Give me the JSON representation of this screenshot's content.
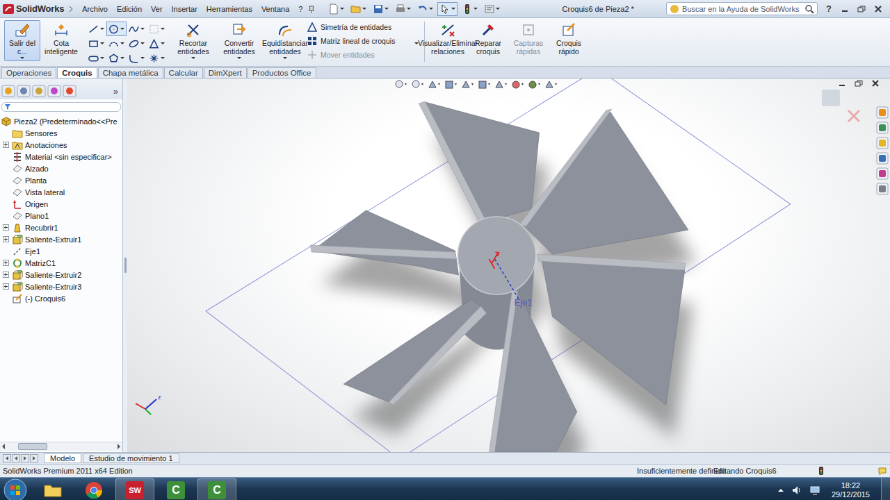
{
  "titlebar": {
    "logo": "SolidWorks",
    "menu": [
      "Archivo",
      "Edición",
      "Ver",
      "Insertar",
      "Herramientas",
      "Ventana",
      "?"
    ],
    "document": "Croquis6 de Pieza2 *",
    "search": {
      "placeholder": "Buscar en la Ayuda de SolidWorks"
    },
    "help": "?"
  },
  "ribbon": {
    "exit": {
      "label": "Salir del c...",
      "selected": true
    },
    "dimension": {
      "label": "Cota inteligente"
    },
    "sketch_tools": [
      {
        "kind": "line",
        "selected": false
      },
      {
        "kind": "circle",
        "selected": true
      },
      {
        "kind": "spline",
        "selected": false
      },
      {
        "kind": "grid",
        "selected": false
      },
      {
        "kind": "rectangle",
        "selected": false
      },
      {
        "kind": "arc",
        "selected": false
      },
      {
        "kind": "ellipse",
        "selected": false
      },
      {
        "kind": "text",
        "selected": false
      },
      {
        "kind": "slot",
        "selected": false
      },
      {
        "kind": "polygon",
        "selected": false
      },
      {
        "kind": "fillet",
        "selected": false
      },
      {
        "kind": "point",
        "selected": false
      }
    ],
    "entity_tools": [
      {
        "label": "Recortar entidades",
        "kind": "trim"
      },
      {
        "label": "Convertir entidades",
        "kind": "convert"
      },
      {
        "label": "Equidistanciar entidades",
        "kind": "offset"
      }
    ],
    "small_tools": [
      {
        "label": "Simetría de entidades",
        "kind": "mirror",
        "disabled": false
      },
      {
        "label": "Matriz lineal de croquis",
        "kind": "pattern",
        "disabled": false
      },
      {
        "label": "Mover entidades",
        "kind": "move",
        "disabled": true
      }
    ],
    "relation_tools": [
      {
        "label": "Visualizar/Eliminar relaciones",
        "kind": "relations",
        "disabled": false
      },
      {
        "label": "Reparar croquis",
        "kind": "repair",
        "disabled": false
      },
      {
        "label": "Capturas rápidas",
        "kind": "snaps",
        "disabled": true
      },
      {
        "label": "Croquis rápido",
        "kind": "rapid",
        "disabled": false
      }
    ]
  },
  "tabs": [
    {
      "label": "Operaciones",
      "selected": false
    },
    {
      "label": "Croquis",
      "selected": true
    },
    {
      "label": "Chapa metálica",
      "selected": false
    },
    {
      "label": "Calcular",
      "selected": false
    },
    {
      "label": "DimXpert",
      "selected": false
    },
    {
      "label": "Productos Office",
      "selected": false
    }
  ],
  "feature_tree": {
    "more": "»",
    "root": {
      "label": "Pieza2  (Predeterminado<<Pre",
      "kind": "part"
    },
    "items": [
      {
        "label": "Sensores",
        "kind": "sensors",
        "expander": false
      },
      {
        "label": "Anotaciones",
        "kind": "annotations",
        "expander": true
      },
      {
        "label": "Material <sin especificar>",
        "kind": "material",
        "expander": false
      },
      {
        "label": "Alzado",
        "kind": "plane",
        "expander": false
      },
      {
        "label": "Planta",
        "kind": "plane",
        "expander": false
      },
      {
        "label": "Vista lateral",
        "kind": "plane",
        "expander": false
      },
      {
        "label": "Origen",
        "kind": "origin",
        "expander": false
      },
      {
        "label": "Plano1",
        "kind": "plane",
        "expander": false
      },
      {
        "label": "Recubrir1",
        "kind": "loft",
        "expander": true
      },
      {
        "label": "Saliente-Extruir1",
        "kind": "extrude",
        "expander": true
      },
      {
        "label": "Eje1",
        "kind": "axis",
        "expander": false
      },
      {
        "label": "MatrizC1",
        "kind": "pattern",
        "expander": true
      },
      {
        "label": "Saliente-Extruir2",
        "kind": "extrude",
        "expander": true
      },
      {
        "label": "Saliente-Extruir3",
        "kind": "extrude",
        "expander": true
      },
      {
        "label": "(-) Croquis6",
        "kind": "sketch",
        "expander": false
      }
    ]
  },
  "graphics": {
    "axis_label": "Eje1",
    "triad_label": "z"
  },
  "bottom_tabs": [
    {
      "label": "Modelo",
      "selected": true
    },
    {
      "label": "Estudio de movimiento 1",
      "selected": false
    }
  ],
  "status_bar": {
    "edition": "SolidWorks Premium 2011 x64 Edition",
    "sketch_state": "Insuficientemente definido",
    "mode": "Editando Croquis6"
  },
  "taskbar": {
    "apps": [
      {
        "kind": "explorer",
        "glyph": "",
        "selected": false
      },
      {
        "kind": "chrome",
        "glyph": "",
        "selected": false
      },
      {
        "kind": "solidworks",
        "glyph": "SW",
        "selected": true
      },
      {
        "kind": "camtasia",
        "glyph": "C",
        "selected": false
      },
      {
        "kind": "camtasia",
        "glyph": "C",
        "selected": true
      }
    ],
    "time": "18:22",
    "date": "29/12/2015"
  }
}
